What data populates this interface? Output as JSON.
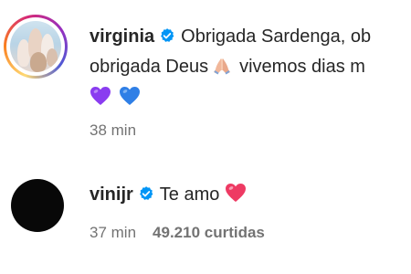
{
  "comments": [
    {
      "username": "virginia",
      "verified": true,
      "text_line1": "Obrigada Sardenga, ob",
      "text_line2_a": "obrigada Deus",
      "text_line2_b": "vivemos dias m",
      "line3_emojis": [
        "purple-heart",
        "blue-heart"
      ],
      "time": "38 min"
    },
    {
      "username": "vinijr",
      "verified": true,
      "text": "Te amo",
      "emoji": "red-heart",
      "time": "37 min",
      "likes": "49.210 curtidas"
    }
  ],
  "colors": {
    "verified_badge": "#0095f6",
    "meta_text": "#737373",
    "purple_heart": "#8a3cf0",
    "blue_heart": "#2f7fe6",
    "red_heart": "#ee3a63"
  }
}
